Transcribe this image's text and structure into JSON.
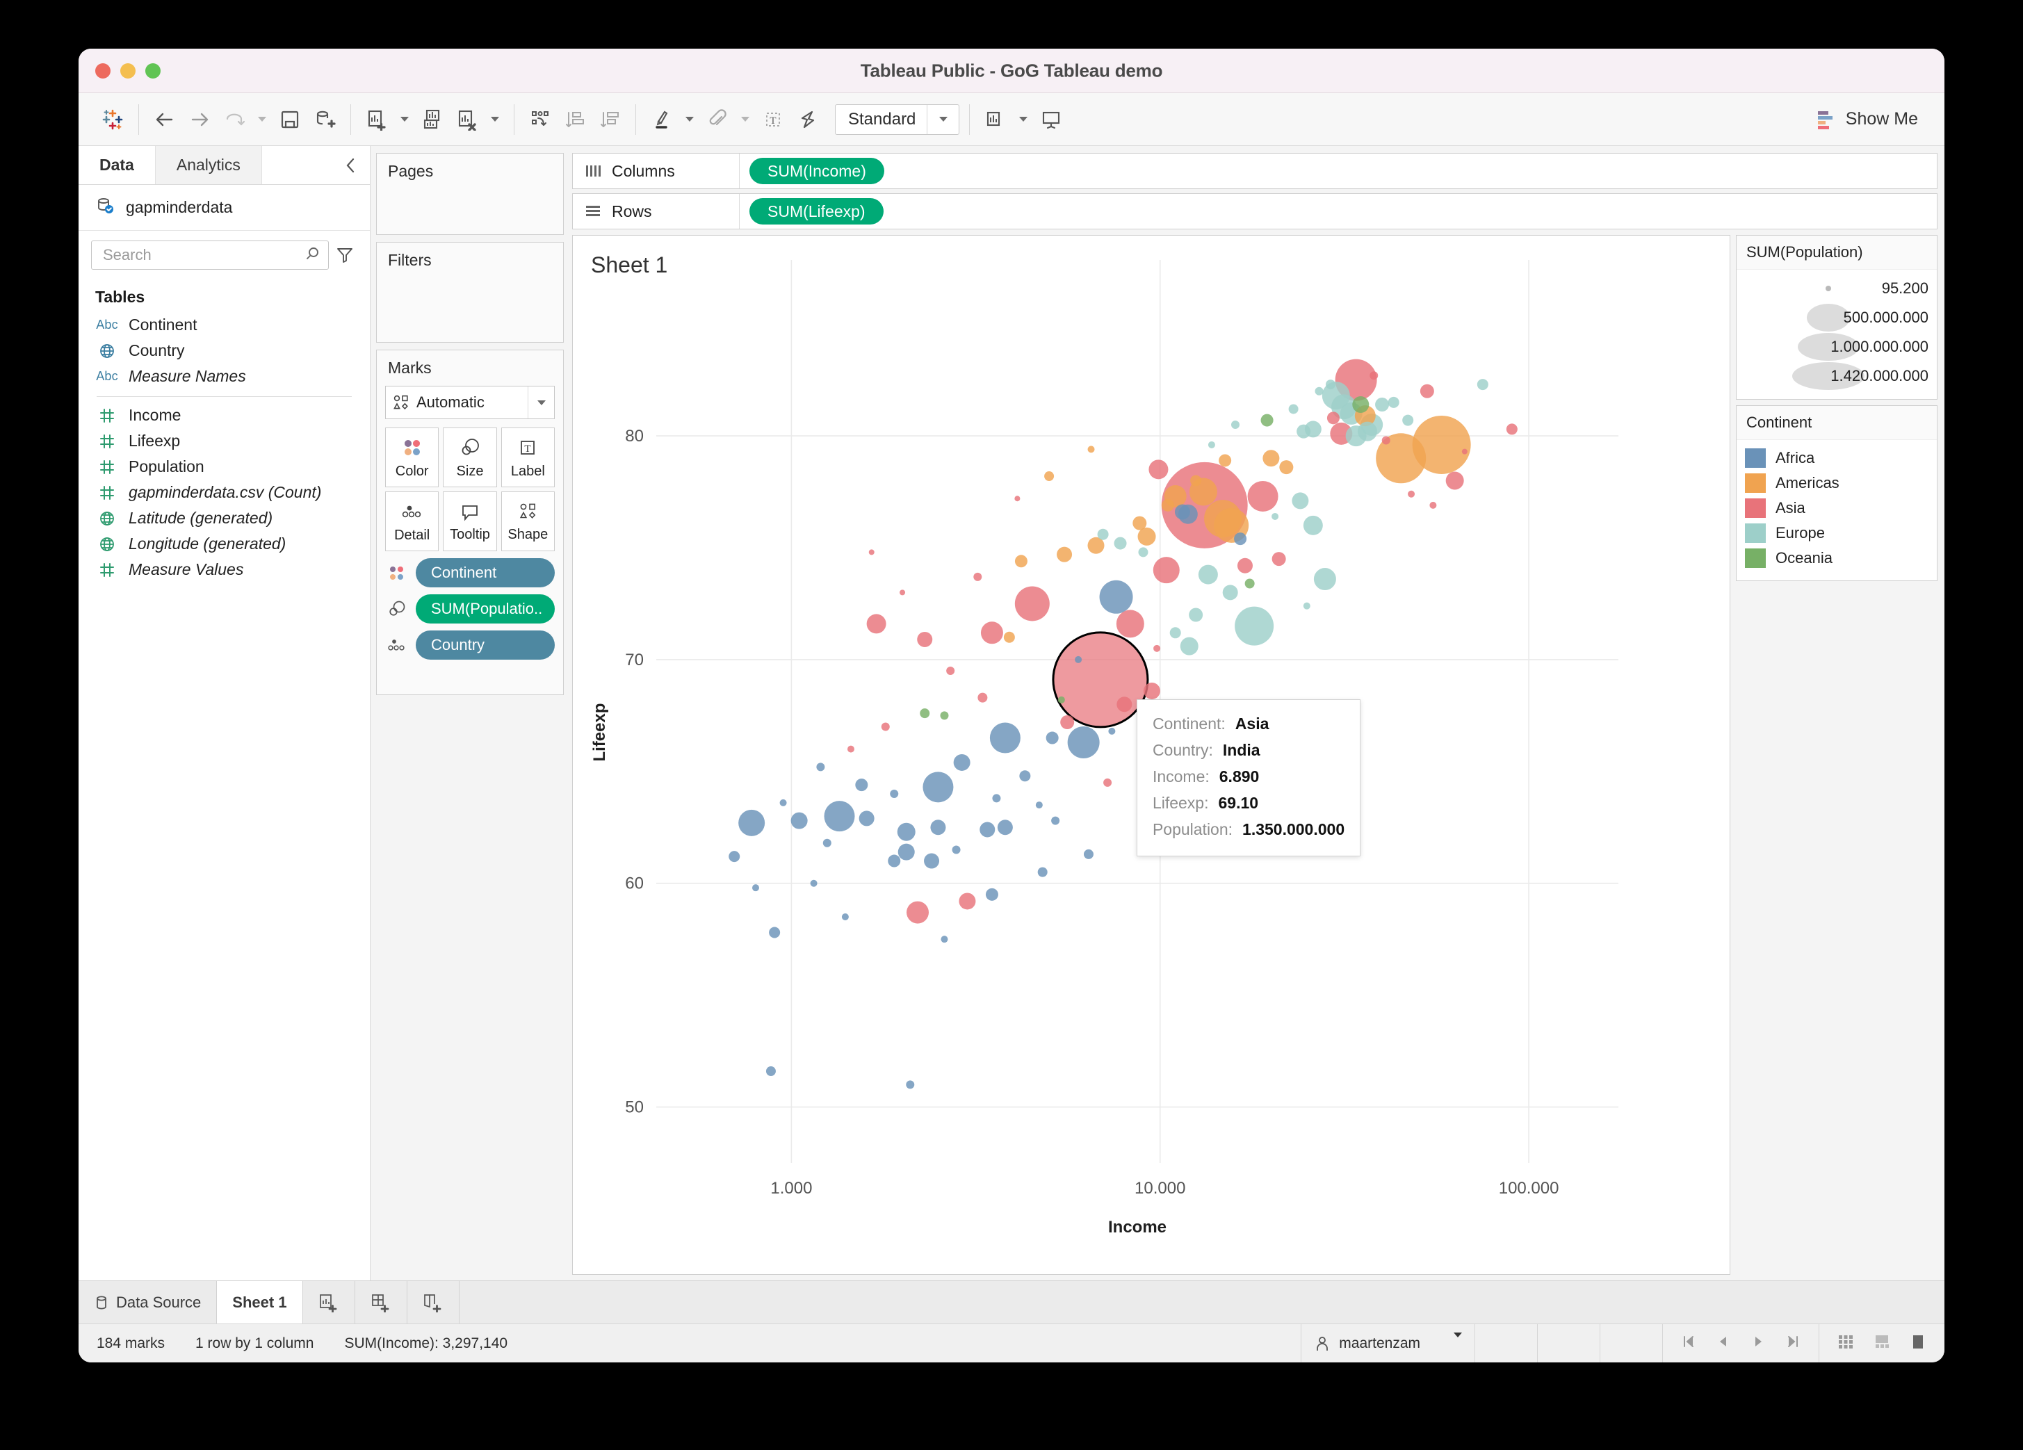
{
  "window": {
    "title": "Tableau Public - GoG Tableau demo"
  },
  "toolbar": {
    "view_mode": "Standard",
    "show_me": "Show Me",
    "icons": [
      "tableau-logo-icon",
      "back-arrow-icon",
      "forward-arrow-icon",
      "redo-icon",
      "save-icon",
      "new-data-source-icon",
      "new-worksheet-icon",
      "duplicate-sheet-icon",
      "clear-sheet-icon",
      "swap-rows-columns-icon",
      "sort-ascending-icon",
      "sort-descending-icon",
      "highlight-icon",
      "attach-icon",
      "text-box-icon",
      "fit-icon",
      "show-hide-cards-icon",
      "presentation-mode-icon"
    ]
  },
  "sidebar": {
    "tabs": [
      {
        "label": "Data",
        "active": true
      },
      {
        "label": "Analytics",
        "active": false
      }
    ],
    "datasource": "gapminderdata",
    "search": {
      "placeholder": "Search",
      "value": ""
    },
    "section_title": "Tables",
    "fields": [
      {
        "label": "Continent",
        "type": "abc",
        "italic": false
      },
      {
        "label": "Country",
        "type": "geo-blue",
        "italic": false
      },
      {
        "label": "Measure Names",
        "type": "abc",
        "italic": true
      },
      {
        "label": "Income",
        "type": "num",
        "italic": false
      },
      {
        "label": "Lifeexp",
        "type": "num",
        "italic": false
      },
      {
        "label": "Population",
        "type": "num",
        "italic": false
      },
      {
        "label": "gapminderdata.csv (Count)",
        "type": "num",
        "italic": true
      },
      {
        "label": "Latitude (generated)",
        "type": "geo-green",
        "italic": true
      },
      {
        "label": "Longitude (generated)",
        "type": "geo-green",
        "italic": true
      },
      {
        "label": "Measure Values",
        "type": "num",
        "italic": true
      }
    ]
  },
  "cards": {
    "pages_title": "Pages",
    "filters_title": "Filters",
    "marks_title": "Marks",
    "mark_type": "Automatic",
    "buttons": [
      {
        "label": "Color",
        "icon": "color-dots-icon"
      },
      {
        "label": "Size",
        "icon": "size-circles-icon"
      },
      {
        "label": "Label",
        "icon": "label-t-icon"
      },
      {
        "label": "Detail",
        "icon": "detail-dots-icon"
      },
      {
        "label": "Tooltip",
        "icon": "tooltip-bubble-icon"
      },
      {
        "label": "Shape",
        "icon": "shape-icon"
      }
    ],
    "pills": [
      {
        "label": "Continent",
        "color": "blue",
        "icon": "color-dots-icon"
      },
      {
        "label": "SUM(Populatio..",
        "color": "green",
        "icon": "size-circles-icon"
      },
      {
        "label": "Country",
        "color": "blue",
        "icon": "detail-dots-icon"
      }
    ]
  },
  "shelves": {
    "columns_label": "Columns",
    "columns_pill": "SUM(Income)",
    "rows_label": "Rows",
    "rows_pill": "SUM(Lifeexp)"
  },
  "sheet": {
    "title": "Sheet 1"
  },
  "legends": {
    "size": {
      "title": "SUM(Population)",
      "entries": [
        {
          "label": "95.200",
          "size": 8
        },
        {
          "label": "500.000.000",
          "size": 62
        },
        {
          "label": "1.000.000.000",
          "size": 88
        },
        {
          "label": "1.420.000.000",
          "size": 104
        }
      ]
    },
    "color": {
      "title": "Continent",
      "entries": [
        {
          "label": "Africa",
          "color": "#6a92b8"
        },
        {
          "label": "Americas",
          "color": "#f0a350"
        },
        {
          "label": "Asia",
          "color": "#e8737a"
        },
        {
          "label": "Europe",
          "color": "#9dcfc9"
        },
        {
          "label": "Oceania",
          "color": "#77b066"
        }
      ]
    }
  },
  "tooltip": {
    "rows": [
      {
        "key": "Continent:",
        "value": "Asia"
      },
      {
        "key": "Country:",
        "value": "India"
      },
      {
        "key": "Income:",
        "value": "6.890"
      },
      {
        "key": "Lifeexp:",
        "value": "69.10"
      },
      {
        "key": "Population:",
        "value": "1.350.000.000"
      }
    ]
  },
  "bottom": {
    "tabs": [
      {
        "label": "Data Source",
        "icon": "database-icon",
        "active": false
      },
      {
        "label": "Sheet 1",
        "icon": "",
        "active": true
      }
    ],
    "new_buttons": [
      "new-worksheet-icon",
      "new-dashboard-icon",
      "new-story-icon"
    ],
    "status": {
      "marks": "184 marks",
      "dims": "1 row by 1 column",
      "aggregate": "SUM(Income): 3,297,140",
      "user": "maartenzam"
    }
  },
  "chart_data": {
    "type": "scatter",
    "title": "Sheet 1",
    "xlabel": "Income",
    "ylabel": "Lifeexp",
    "x_scale": "log",
    "x_ticks": [
      "1.000",
      "10.000",
      "100.000"
    ],
    "x_tick_values": [
      1000,
      10000,
      100000
    ],
    "xlim": [
      430,
      175000
    ],
    "y_ticks": [
      "50",
      "60",
      "70",
      "80"
    ],
    "y_tick_values": [
      50,
      60,
      70,
      80
    ],
    "ylim": [
      47.5,
      86
    ],
    "grid": true,
    "legend_position": "right",
    "size_field": "SUM(Population)",
    "color_field": "Continent",
    "highlighted": {
      "country": "India",
      "continent": "Asia",
      "income": 6890,
      "lifeexp": 69.1,
      "population": 1350000000
    },
    "colors": {
      "Africa": "#6a92b8",
      "Americas": "#f0a350",
      "Asia": "#e8737a",
      "Europe": "#9dcfc9",
      "Oceania": "#77b066"
    },
    "points": [
      {
        "x": 6890,
        "y": 69.1,
        "r": 68,
        "c": "Asia",
        "hl": true
      },
      {
        "x": 13200,
        "y": 76.9,
        "r": 62,
        "c": "Asia"
      },
      {
        "x": 14800,
        "y": 76.3,
        "r": 27,
        "c": "Americas"
      },
      {
        "x": 13100,
        "y": 77.5,
        "r": 20,
        "c": "Americas"
      },
      {
        "x": 11000,
        "y": 77.3,
        "r": 16,
        "c": "Americas"
      },
      {
        "x": 15600,
        "y": 76.0,
        "r": 25,
        "c": "Americas"
      },
      {
        "x": 11500,
        "y": 76.6,
        "r": 11,
        "c": "Africa"
      },
      {
        "x": 11900,
        "y": 76.5,
        "r": 14,
        "c": "Africa"
      },
      {
        "x": 16500,
        "y": 75.4,
        "r": 9,
        "c": "Africa"
      },
      {
        "x": 45000,
        "y": 79.0,
        "r": 36,
        "c": "Americas"
      },
      {
        "x": 9900,
        "y": 78.5,
        "r": 14,
        "c": "Asia"
      },
      {
        "x": 10400,
        "y": 74.0,
        "r": 19,
        "c": "Asia"
      },
      {
        "x": 4500,
        "y": 72.5,
        "r": 25,
        "c": "Asia"
      },
      {
        "x": 3500,
        "y": 71.2,
        "r": 16,
        "c": "Asia"
      },
      {
        "x": 2300,
        "y": 70.9,
        "r": 11,
        "c": "Asia"
      },
      {
        "x": 1700,
        "y": 71.6,
        "r": 14,
        "c": "Asia"
      },
      {
        "x": 7600,
        "y": 72.8,
        "r": 24,
        "c": "Africa"
      },
      {
        "x": 8300,
        "y": 71.6,
        "r": 20,
        "c": "Asia"
      },
      {
        "x": 6200,
        "y": 66.3,
        "r": 23,
        "c": "Africa"
      },
      {
        "x": 3800,
        "y": 66.5,
        "r": 22,
        "c": "Africa"
      },
      {
        "x": 2500,
        "y": 64.3,
        "r": 22,
        "c": "Africa"
      },
      {
        "x": 1350,
        "y": 63.0,
        "r": 22,
        "c": "Africa"
      },
      {
        "x": 1600,
        "y": 62.9,
        "r": 11,
        "c": "Africa"
      },
      {
        "x": 2050,
        "y": 62.3,
        "r": 13,
        "c": "Africa"
      },
      {
        "x": 2500,
        "y": 62.5,
        "r": 11,
        "c": "Africa"
      },
      {
        "x": 3400,
        "y": 62.4,
        "r": 11,
        "c": "Africa"
      },
      {
        "x": 3800,
        "y": 62.5,
        "r": 11,
        "c": "Africa"
      },
      {
        "x": 1900,
        "y": 61.0,
        "r": 9,
        "c": "Africa"
      },
      {
        "x": 2050,
        "y": 61.4,
        "r": 12,
        "c": "Africa"
      },
      {
        "x": 2400,
        "y": 61.0,
        "r": 11,
        "c": "Africa"
      },
      {
        "x": 3500,
        "y": 59.5,
        "r": 9,
        "c": "Africa"
      },
      {
        "x": 2200,
        "y": 58.7,
        "r": 16,
        "c": "Asia"
      },
      {
        "x": 900,
        "y": 57.8,
        "r": 8,
        "c": "Africa"
      },
      {
        "x": 880,
        "y": 51.6,
        "r": 7,
        "c": "Africa"
      },
      {
        "x": 2100,
        "y": 51.0,
        "r": 6,
        "c": "Africa"
      },
      {
        "x": 780,
        "y": 62.7,
        "r": 19,
        "c": "Africa"
      },
      {
        "x": 1050,
        "y": 62.8,
        "r": 12,
        "c": "Africa"
      },
      {
        "x": 700,
        "y": 61.2,
        "r": 8,
        "c": "Africa"
      },
      {
        "x": 34000,
        "y": 82.5,
        "r": 30,
        "c": "Asia"
      },
      {
        "x": 30000,
        "y": 81.8,
        "r": 20,
        "c": "Europe"
      },
      {
        "x": 31500,
        "y": 81.3,
        "r": 18,
        "c": "Europe"
      },
      {
        "x": 33000,
        "y": 81.0,
        "r": 16,
        "c": "Europe"
      },
      {
        "x": 35000,
        "y": 81.4,
        "r": 12,
        "c": "Oceania"
      },
      {
        "x": 36000,
        "y": 80.9,
        "r": 15,
        "c": "Americas"
      },
      {
        "x": 40000,
        "y": 81.4,
        "r": 10,
        "c": "Europe"
      },
      {
        "x": 29500,
        "y": 80.8,
        "r": 9,
        "c": "Asia"
      },
      {
        "x": 37500,
        "y": 80.5,
        "r": 16,
        "c": "Europe"
      },
      {
        "x": 34000,
        "y": 80.0,
        "r": 15,
        "c": "Europe"
      },
      {
        "x": 36500,
        "y": 80.2,
        "r": 14,
        "c": "Europe"
      },
      {
        "x": 31000,
        "y": 80.1,
        "r": 16,
        "c": "Asia"
      },
      {
        "x": 26000,
        "y": 80.3,
        "r": 12,
        "c": "Europe"
      },
      {
        "x": 24500,
        "y": 80.2,
        "r": 10,
        "c": "Europe"
      },
      {
        "x": 43000,
        "y": 81.5,
        "r": 8,
        "c": "Europe"
      },
      {
        "x": 47000,
        "y": 80.7,
        "r": 8,
        "c": "Europe"
      },
      {
        "x": 53000,
        "y": 82.0,
        "r": 10,
        "c": "Asia"
      },
      {
        "x": 75000,
        "y": 82.3,
        "r": 8,
        "c": "Europe"
      },
      {
        "x": 20000,
        "y": 79.0,
        "r": 12,
        "c": "Americas"
      },
      {
        "x": 22000,
        "y": 78.6,
        "r": 10,
        "c": "Americas"
      },
      {
        "x": 19000,
        "y": 77.3,
        "r": 22,
        "c": "Asia"
      },
      {
        "x": 24000,
        "y": 77.1,
        "r": 12,
        "c": "Europe"
      },
      {
        "x": 58000,
        "y": 79.6,
        "r": 42,
        "c": "Americas"
      },
      {
        "x": 63000,
        "y": 78.0,
        "r": 13,
        "c": "Asia"
      },
      {
        "x": 90000,
        "y": 80.3,
        "r": 8,
        "c": "Asia"
      },
      {
        "x": 26000,
        "y": 76.0,
        "r": 14,
        "c": "Europe"
      },
      {
        "x": 28000,
        "y": 73.6,
        "r": 16,
        "c": "Europe"
      },
      {
        "x": 21000,
        "y": 74.5,
        "r": 10,
        "c": "Asia"
      },
      {
        "x": 17000,
        "y": 74.2,
        "r": 11,
        "c": "Asia"
      },
      {
        "x": 18000,
        "y": 71.5,
        "r": 28,
        "c": "Europe"
      },
      {
        "x": 12000,
        "y": 70.6,
        "r": 13,
        "c": "Europe"
      },
      {
        "x": 9500,
        "y": 68.6,
        "r": 12,
        "c": "Asia"
      },
      {
        "x": 8000,
        "y": 68.0,
        "r": 11,
        "c": "Asia"
      },
      {
        "x": 5600,
        "y": 67.2,
        "r": 10,
        "c": "Asia"
      },
      {
        "x": 5100,
        "y": 66.5,
        "r": 9,
        "c": "Africa"
      },
      {
        "x": 4300,
        "y": 64.8,
        "r": 8,
        "c": "Africa"
      },
      {
        "x": 3000,
        "y": 59.2,
        "r": 12,
        "c": "Asia"
      },
      {
        "x": 1200,
        "y": 65.2,
        "r": 6,
        "c": "Africa"
      },
      {
        "x": 1550,
        "y": 64.4,
        "r": 9,
        "c": "Africa"
      },
      {
        "x": 2900,
        "y": 65.4,
        "r": 12,
        "c": "Africa"
      },
      {
        "x": 4800,
        "y": 60.5,
        "r": 7,
        "c": "Africa"
      },
      {
        "x": 6400,
        "y": 61.3,
        "r": 7,
        "c": "Africa"
      },
      {
        "x": 2300,
        "y": 67.6,
        "r": 7,
        "c": "Oceania"
      },
      {
        "x": 2600,
        "y": 67.5,
        "r": 6,
        "c": "Oceania"
      },
      {
        "x": 5400,
        "y": 68.2,
        "r": 5,
        "c": "Oceania"
      },
      {
        "x": 17500,
        "y": 73.4,
        "r": 7,
        "c": "Oceania"
      },
      {
        "x": 19500,
        "y": 80.7,
        "r": 9,
        "c": "Oceania"
      },
      {
        "x": 3200,
        "y": 73.7,
        "r": 6,
        "c": "Asia"
      },
      {
        "x": 7000,
        "y": 75.6,
        "r": 8,
        "c": "Europe"
      },
      {
        "x": 7800,
        "y": 75.2,
        "r": 9,
        "c": "Europe"
      },
      {
        "x": 9000,
        "y": 74.8,
        "r": 7,
        "c": "Europe"
      },
      {
        "x": 13500,
        "y": 73.8,
        "r": 14,
        "c": "Europe"
      },
      {
        "x": 15500,
        "y": 73.0,
        "r": 11,
        "c": "Europe"
      },
      {
        "x": 12500,
        "y": 72.0,
        "r": 10,
        "c": "Europe"
      },
      {
        "x": 11000,
        "y": 71.2,
        "r": 8,
        "c": "Europe"
      },
      {
        "x": 4200,
        "y": 74.4,
        "r": 9,
        "c": "Americas"
      },
      {
        "x": 5500,
        "y": 74.7,
        "r": 11,
        "c": "Americas"
      },
      {
        "x": 6700,
        "y": 75.1,
        "r": 12,
        "c": "Americas"
      },
      {
        "x": 9200,
        "y": 75.5,
        "r": 13,
        "c": "Americas"
      },
      {
        "x": 8800,
        "y": 76.1,
        "r": 10,
        "c": "Americas"
      },
      {
        "x": 10500,
        "y": 76.9,
        "r": 9,
        "c": "Americas"
      },
      {
        "x": 12500,
        "y": 78.0,
        "r": 8,
        "c": "Americas"
      },
      {
        "x": 15000,
        "y": 78.9,
        "r": 9,
        "c": "Americas"
      },
      {
        "x": 5000,
        "y": 78.2,
        "r": 7,
        "c": "Americas"
      },
      {
        "x": 3900,
        "y": 71.0,
        "r": 8,
        "c": "Americas"
      },
      {
        "x": 2700,
        "y": 69.5,
        "r": 6,
        "c": "Asia"
      },
      {
        "x": 3300,
        "y": 68.3,
        "r": 7,
        "c": "Asia"
      },
      {
        "x": 1800,
        "y": 67.0,
        "r": 6,
        "c": "Asia"
      },
      {
        "x": 1450,
        "y": 66.0,
        "r": 5,
        "c": "Asia"
      },
      {
        "x": 2000,
        "y": 73.0,
        "r": 4,
        "c": "Asia"
      },
      {
        "x": 6000,
        "y": 70.0,
        "r": 5,
        "c": "Africa"
      },
      {
        "x": 7400,
        "y": 66.8,
        "r": 5,
        "c": "Africa"
      },
      {
        "x": 4700,
        "y": 63.5,
        "r": 5,
        "c": "Africa"
      },
      {
        "x": 1150,
        "y": 60.0,
        "r": 5,
        "c": "Africa"
      },
      {
        "x": 950,
        "y": 63.6,
        "r": 5,
        "c": "Africa"
      },
      {
        "x": 1250,
        "y": 61.8,
        "r": 6,
        "c": "Africa"
      },
      {
        "x": 1900,
        "y": 64.0,
        "r": 6,
        "c": "Africa"
      },
      {
        "x": 2800,
        "y": 61.5,
        "r": 6,
        "c": "Africa"
      },
      {
        "x": 3600,
        "y": 63.8,
        "r": 6,
        "c": "Africa"
      },
      {
        "x": 5200,
        "y": 62.8,
        "r": 6,
        "c": "Africa"
      },
      {
        "x": 23000,
        "y": 81.2,
        "r": 7,
        "c": "Europe"
      },
      {
        "x": 27000,
        "y": 82.0,
        "r": 6,
        "c": "Europe"
      },
      {
        "x": 29000,
        "y": 82.3,
        "r": 7,
        "c": "Europe"
      },
      {
        "x": 38000,
        "y": 82.7,
        "r": 6,
        "c": "Asia"
      },
      {
        "x": 41000,
        "y": 79.8,
        "r": 6,
        "c": "Asia"
      },
      {
        "x": 48000,
        "y": 77.4,
        "r": 5,
        "c": "Asia"
      },
      {
        "x": 55000,
        "y": 76.9,
        "r": 5,
        "c": "Asia"
      },
      {
        "x": 67000,
        "y": 79.3,
        "r": 4,
        "c": "Asia"
      },
      {
        "x": 6500,
        "y": 79.4,
        "r": 5,
        "c": "Americas"
      },
      {
        "x": 4100,
        "y": 77.2,
        "r": 4,
        "c": "Asia"
      },
      {
        "x": 1650,
        "y": 74.8,
        "r": 4,
        "c": "Asia"
      },
      {
        "x": 16000,
        "y": 80.5,
        "r": 6,
        "c": "Europe"
      },
      {
        "x": 13800,
        "y": 79.6,
        "r": 5,
        "c": "Europe"
      },
      {
        "x": 20500,
        "y": 76.4,
        "r": 5,
        "c": "Europe"
      },
      {
        "x": 25000,
        "y": 72.4,
        "r": 5,
        "c": "Europe"
      },
      {
        "x": 9800,
        "y": 70.5,
        "r": 5,
        "c": "Asia"
      },
      {
        "x": 7200,
        "y": 64.5,
        "r": 6,
        "c": "Asia"
      },
      {
        "x": 2600,
        "y": 57.5,
        "r": 5,
        "c": "Africa"
      },
      {
        "x": 1400,
        "y": 58.5,
        "r": 5,
        "c": "Africa"
      },
      {
        "x": 800,
        "y": 59.8,
        "r": 5,
        "c": "Africa"
      }
    ]
  }
}
